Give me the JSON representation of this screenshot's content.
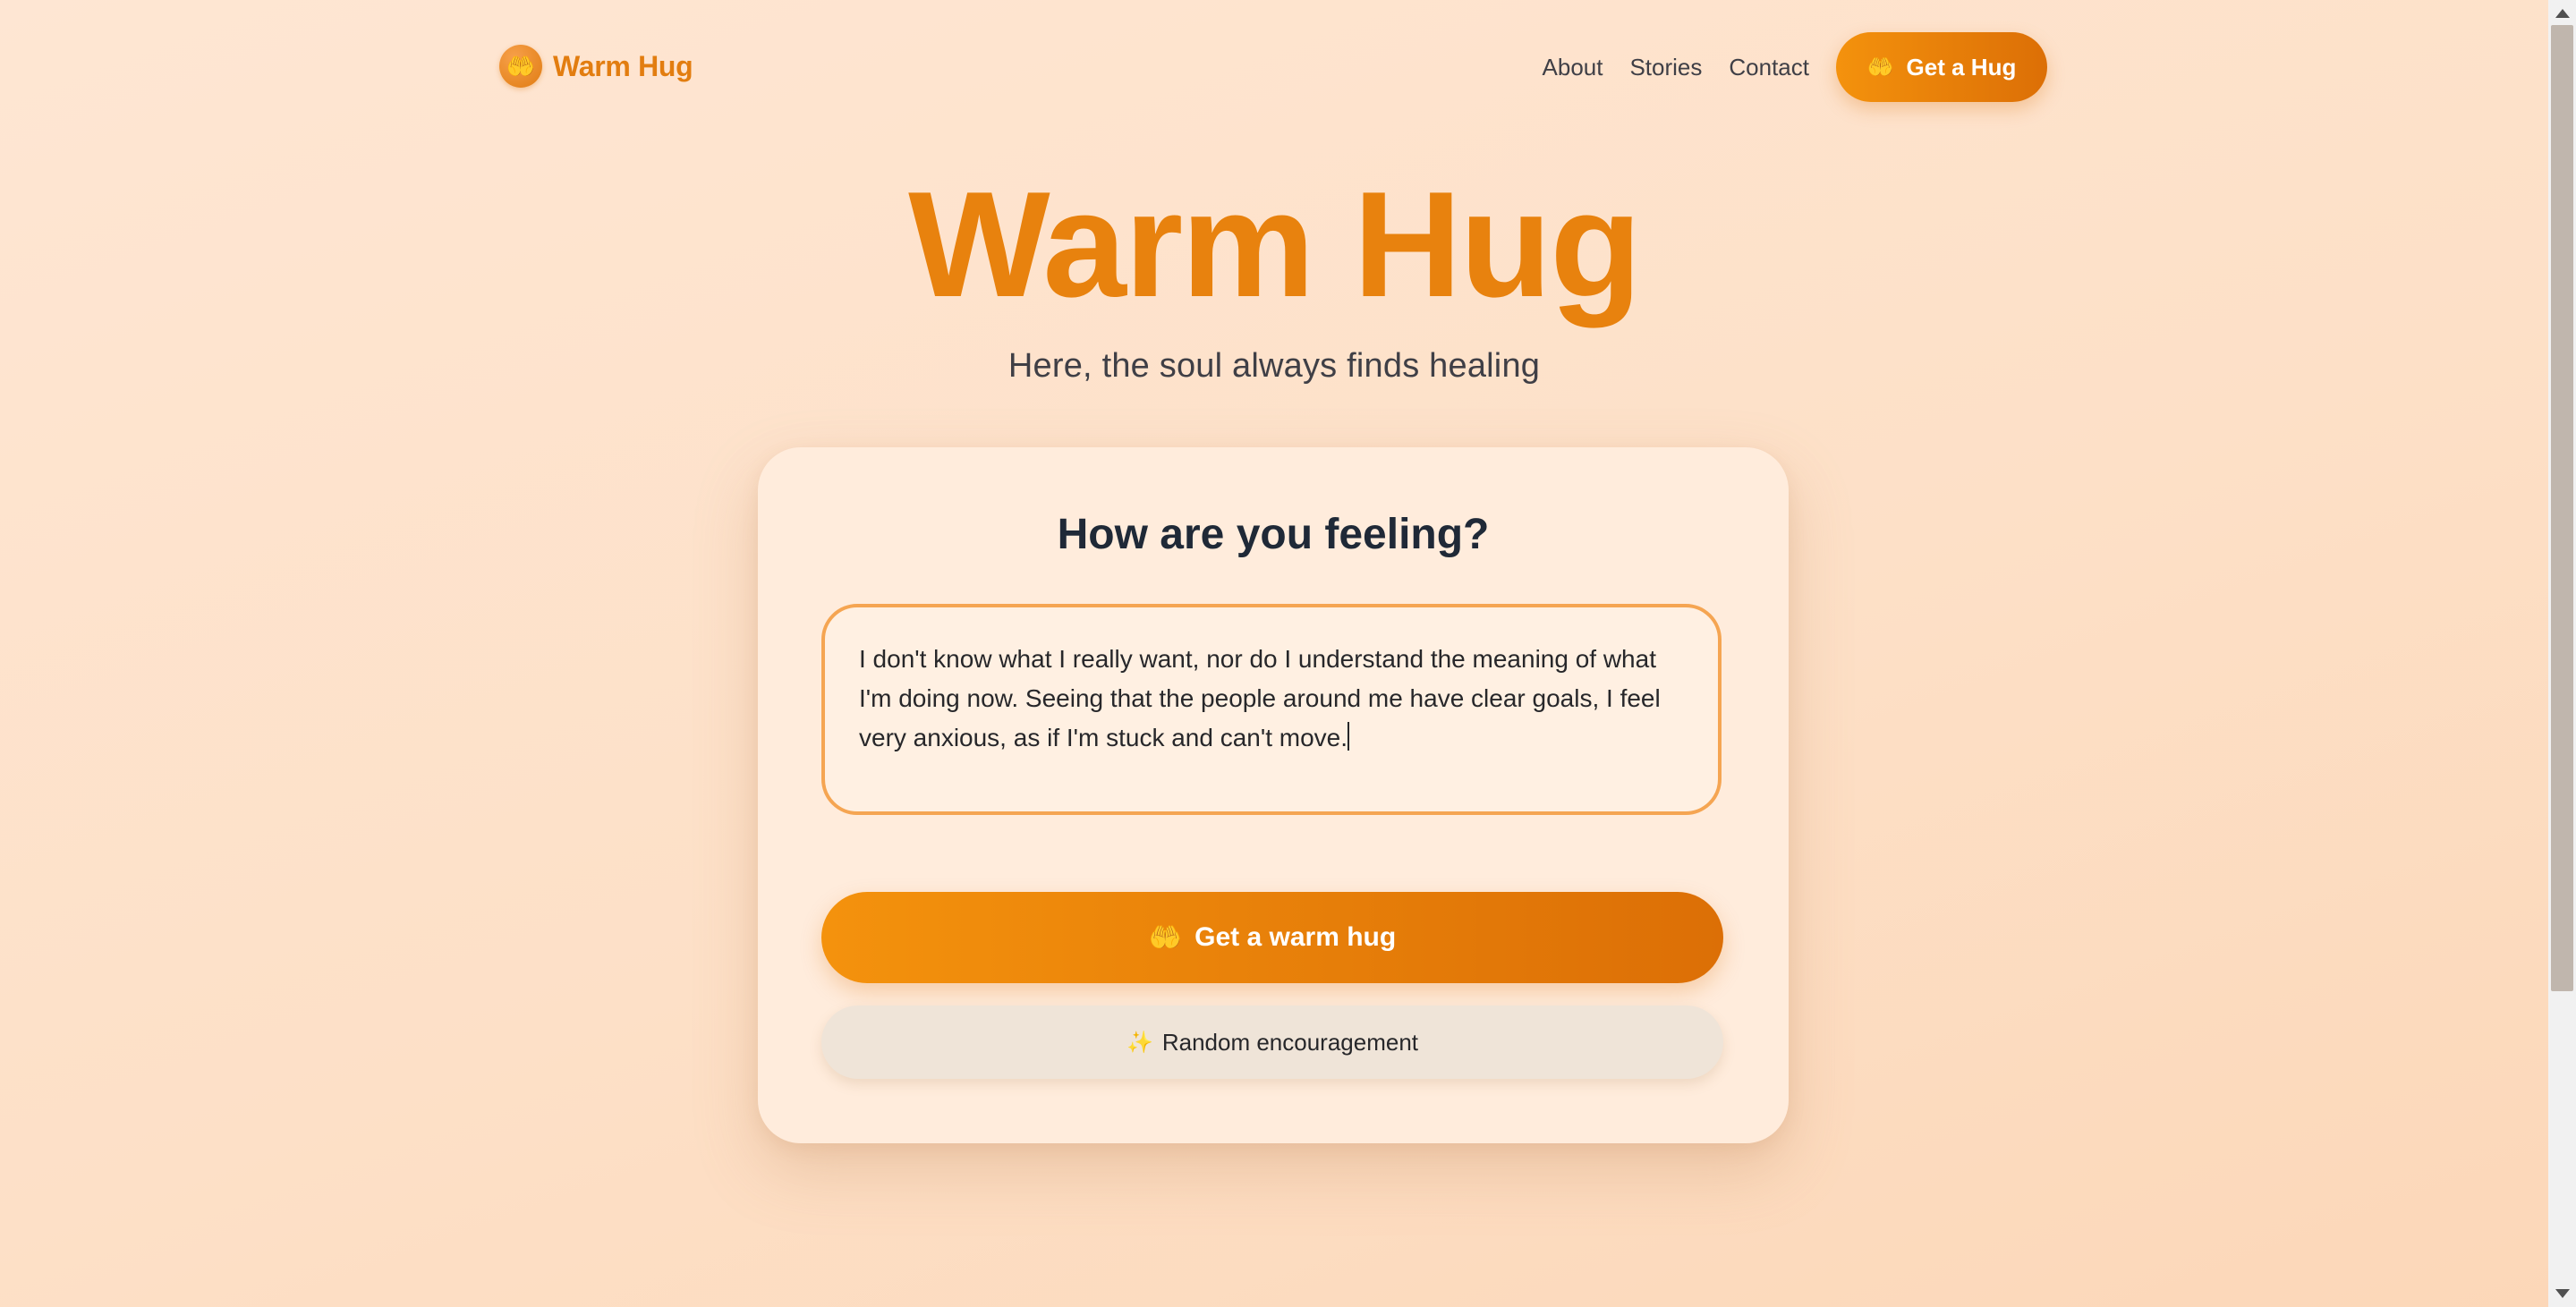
{
  "nav": {
    "brand_icon": "🤲",
    "brand_name": "Warm Hug",
    "links": [
      "About",
      "Stories",
      "Contact"
    ],
    "cta_icon": "🤲",
    "cta_label": "Get a Hug"
  },
  "hero": {
    "title": "Warm Hug",
    "subtitle": "Here, the soul always finds healing"
  },
  "card": {
    "title": "How are you feeling?",
    "textarea_value": "I don't know what I really want, nor do I understand the meaning of what I'm doing now. Seeing that the people around me have clear goals, I feel very anxious, as if I'm stuck and can't move.",
    "primary_icon": "🤲",
    "primary_label": "Get a warm hug",
    "secondary_icon": "✨",
    "secondary_label": "Random encouragement"
  },
  "colors": {
    "accent": "#e8820e",
    "accent_dark": "#dc6f06",
    "background": "#fee6d3",
    "card": "#ffecdc",
    "text": "#1f2937"
  }
}
